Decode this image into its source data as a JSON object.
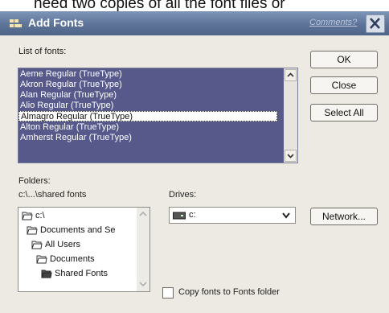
{
  "page": {
    "caption_fragment": "need two copies of all the font files or"
  },
  "window": {
    "title": "Add Fonts",
    "comments_link": "Comments?"
  },
  "font_list": {
    "label": "List of fonts:",
    "items": [
      "Aeme Regular (TrueType)",
      "Akron Regular (TrueType)",
      "Alan Regular (TrueType)",
      "Alio Regular (TrueType)",
      "Almagro Regular (TrueType)",
      "Alton Regular (TrueType)",
      "Amherst Regular (TrueType)"
    ],
    "selected": "Almagro Regular (TrueType)"
  },
  "buttons": {
    "ok": "OK",
    "close": "Close",
    "select_all": "Select All",
    "network": "Network..."
  },
  "folders": {
    "label": "Folders:",
    "path": "c:\\...\\shared fonts",
    "tree": [
      "c:\\",
      "Documents and Se",
      "All Users",
      "Documents",
      "Shared Fonts"
    ]
  },
  "drives": {
    "label": "Drives:",
    "value": "c:"
  },
  "copy_option": {
    "label": "Copy fonts to Fonts folder",
    "checked": false
  },
  "colors": {
    "titlebar": "#5d7398",
    "list_highlight": "#56598a",
    "dialog_bg": "#eceae2"
  },
  "icons": [
    "app-icon",
    "close-icon",
    "scroll-up-icon",
    "scroll-down-icon",
    "folder-open-icon",
    "drive-icon",
    "chevron-down-icon"
  ]
}
